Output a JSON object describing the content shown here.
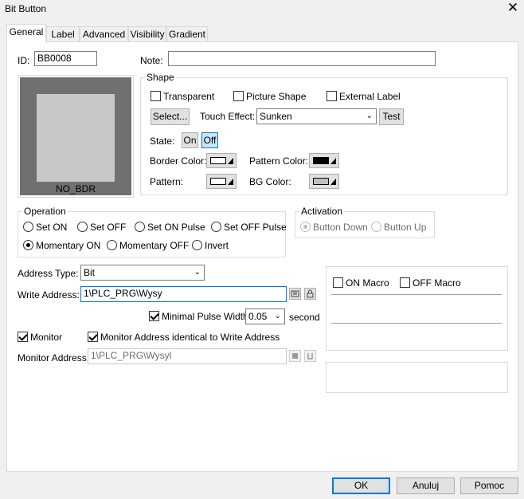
{
  "window": {
    "title": "Bit Button"
  },
  "tabs": [
    {
      "label": "General"
    },
    {
      "label": "Label"
    },
    {
      "label": "Advanced"
    },
    {
      "label": "Visibility"
    },
    {
      "label": "Gradient"
    }
  ],
  "general": {
    "id_label": "ID:",
    "id_value": "BB0008",
    "note_label": "Note:",
    "note_value": "",
    "preview_label": "NO_BDR"
  },
  "shape": {
    "group_label": "Shape",
    "transparent": "Transparent",
    "picture_shape": "Picture Shape",
    "external_label": "External Label",
    "select_button": "Select...",
    "touch_effect_label": "Touch Effect:",
    "touch_effect_value": "Sunken",
    "test_button": "Test",
    "state_label": "State:",
    "state_on": "On",
    "state_off": "Off",
    "border_color_label": "Border Color:",
    "pattern_color_label": "Pattern Color:",
    "pattern_label": "Pattern:",
    "bg_color_label": "BG Color:",
    "colors": {
      "border": "#ffffff",
      "pattern_color": "#000000",
      "pattern": "#ffffff",
      "bg": "#c0c0c0"
    }
  },
  "operation": {
    "group_label": "Operation",
    "options": [
      "Set ON",
      "Set OFF",
      "Set ON Pulse",
      "Set OFF Pulse",
      "Momentary ON",
      "Momentary OFF",
      "Invert"
    ],
    "selected": "Momentary ON"
  },
  "activation": {
    "group_label": "Activation",
    "options": [
      "Button Down",
      "Button Up"
    ],
    "selected": "Button Down"
  },
  "address": {
    "address_type_label": "Address Type:",
    "address_type_value": "Bit",
    "write_address_label": "Write Address:",
    "write_address_value": "1\\PLC_PRG\\Wysy",
    "minimal_pulse_label": "Minimal Pulse Width",
    "minimal_pulse_value": "0.05",
    "second_label": "second",
    "monitor_label": "Monitor",
    "monitor_identical_label": "Monitor Address identical to Write Address",
    "monitor_address_label": "Monitor Address:",
    "monitor_address_value": "1\\PLC_PRG\\Wysyl"
  },
  "macro": {
    "on_macro": "ON Macro",
    "off_macro": "OFF Macro"
  },
  "footer": {
    "ok": "OK",
    "cancel": "Anuluj",
    "help": "Pomoc"
  }
}
